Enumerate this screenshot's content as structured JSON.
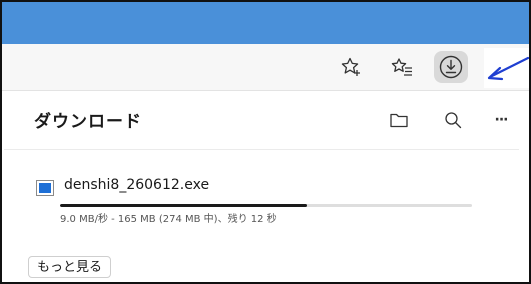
{
  "browser": {
    "toolbar": {
      "favorite_icon": "star-plus-icon",
      "favorites_icon": "favorites-list-icon",
      "downloads_icon": "download-icon"
    }
  },
  "downloads_panel": {
    "title": "ダウンロード",
    "header_icons": [
      "folder-icon",
      "search-icon",
      "more-icon"
    ],
    "more_glyph": "···",
    "items": [
      {
        "file_name": "denshi8_260612.exe",
        "status": "9.0 MB/秒 - 165 MB (274 MB 中)、残り 12 秒",
        "progress": 0.6,
        "file_icon": "exe-file-icon"
      }
    ],
    "see_more_label": "もっと見る"
  },
  "colors": {
    "title_strip": "#4a90d9",
    "toolbar_bg": "#f7f7f7",
    "download_button_bg": "#d9d9d9",
    "annotation_arrow": "#1f3fd1",
    "file_icon_fill": "#1e6fd6",
    "progress_fill": "#1a1a1a"
  }
}
